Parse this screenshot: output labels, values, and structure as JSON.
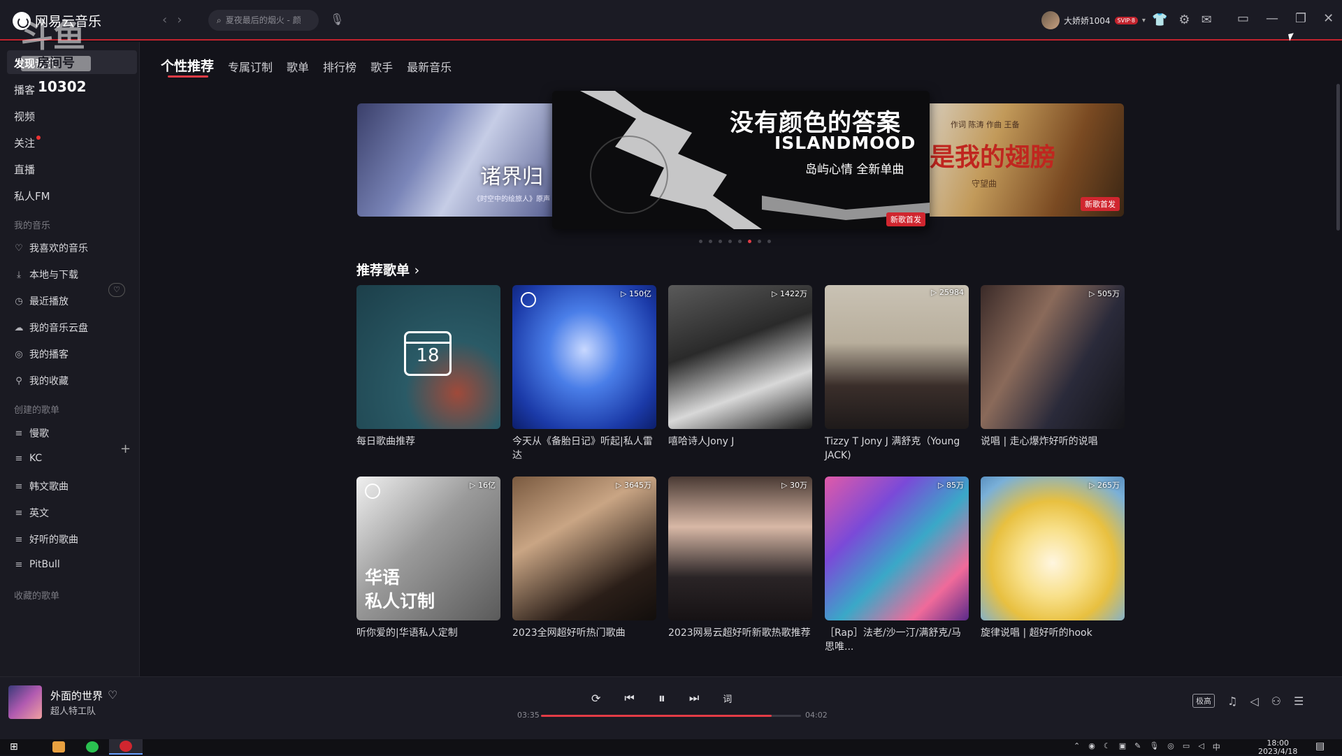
{
  "app": {
    "name": "网易云音乐"
  },
  "watermark": {
    "text": "斗鱼",
    "sub": "房间号",
    "number": "10302"
  },
  "search": {
    "placeholder": "夏夜最后的烟火 - 颜"
  },
  "user": {
    "name": "大娇娇1004",
    "vip": "SVIP·8"
  },
  "sidebar": {
    "discover": "发现音乐",
    "podcast": "播客",
    "video": "视频",
    "follow": "关注",
    "live": "直播",
    "fm": "私人FM",
    "my_music_header": "我的音乐",
    "my_items": [
      {
        "label": "我喜欢的音乐",
        "icon": "heart-outline-icon"
      },
      {
        "label": "本地与下载",
        "icon": "download-icon"
      },
      {
        "label": "最近播放",
        "icon": "clock-icon"
      },
      {
        "label": "我的音乐云盘",
        "icon": "cloud-icon"
      },
      {
        "label": "我的播客",
        "icon": "podcast-icon"
      },
      {
        "label": "我的收藏",
        "icon": "collection-icon"
      }
    ],
    "created_header": "创建的歌单",
    "created": [
      {
        "label": "慢歌"
      },
      {
        "label": "KC"
      },
      {
        "label": "韩文歌曲"
      },
      {
        "label": "英文"
      },
      {
        "label": "好听的歌曲"
      },
      {
        "label": "PitBull"
      }
    ],
    "collected_header": "收藏的歌单"
  },
  "tabs": [
    {
      "label": "个性推荐",
      "active": true
    },
    {
      "label": "专属订制"
    },
    {
      "label": "歌单"
    },
    {
      "label": "排行榜"
    },
    {
      "label": "歌手"
    },
    {
      "label": "最新音乐"
    }
  ],
  "banner": {
    "left_title": "诸界归",
    "left_sub": "《时空中的绘旅人》原声",
    "main_title": "没有颜色的答案",
    "main_en": "ISLANDMOOD",
    "main_sub": "岛屿心情  全新单曲",
    "main_badge": "新歌首发",
    "right_title": "是我的翅膀",
    "right_credits": "作词 陈涛  作曲 王备",
    "right_sub": "守望曲",
    "right_badge": "新歌首发",
    "dot_count": 8,
    "active_dot": 5
  },
  "section": {
    "title": "推荐歌单"
  },
  "playlists": [
    {
      "title": "每日歌曲推荐",
      "plays": "",
      "cover": "calendar",
      "day": "18"
    },
    {
      "title": "今天从《备胎日记》听起|私人雷达",
      "plays": "150亿"
    },
    {
      "title": "嘻哈诗人Jony J",
      "plays": "1422万"
    },
    {
      "title": "Tizzy T Jony J 满舒克（Young JACK)",
      "plays": "25984"
    },
    {
      "title": "说唱 | 走心爆炸好听的说唱",
      "plays": "505万"
    },
    {
      "title": "听你爱的|华语私人定制",
      "plays": "16亿",
      "overlay": "华语\n私人订制"
    },
    {
      "title": "2023全网超好听热门歌曲",
      "plays": "3645万"
    },
    {
      "title": "2023网易云超好听新歌热歌推荐",
      "plays": "30万"
    },
    {
      "title": "［Rap］法老/沙一汀/满舒克/马思唯...",
      "plays": "85万"
    },
    {
      "title": "旋律说唱 | 超好听的hook",
      "plays": "265万"
    }
  ],
  "player": {
    "song": "外面的世界",
    "artist": "超人特工队",
    "current": "03:35",
    "total": "04:02",
    "progress": 0.888,
    "quality": "极高",
    "lyric_btn": "词"
  },
  "taskbar": {
    "ime": "中",
    "time": "18:00",
    "date": "2023/4/18"
  },
  "colors": {
    "accent": "#e33c46",
    "bg": "#13131a",
    "sidebar": "#1a1a22"
  }
}
